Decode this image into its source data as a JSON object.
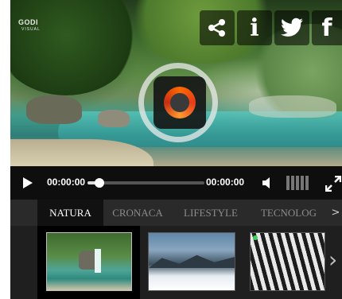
{
  "logo": {
    "text": "GODI",
    "sub": "VISUAL"
  },
  "share": {
    "buttons": [
      {
        "name": "share",
        "icon": "share-icon"
      },
      {
        "name": "info",
        "icon": "info-icon",
        "glyph": "i"
      },
      {
        "name": "twitter",
        "icon": "twitter-icon"
      },
      {
        "name": "facebook",
        "icon": "facebook-icon",
        "glyph": "f"
      }
    ]
  },
  "loader": {
    "icon": "loading-spinner-icon",
    "accent": "#ff6a00"
  },
  "controls": {
    "play_icon": "play-icon",
    "current_time": "00:00:00",
    "total_time": "00:00:00",
    "progress_fraction": 0.1,
    "volume_icon": "speaker-icon",
    "volume_bars_total": 5,
    "volume_bars_on": 0,
    "fullscreen_icon": "fullscreen-icon"
  },
  "tabs": {
    "items": [
      {
        "label": "NATURA",
        "active": true
      },
      {
        "label": "CRONACA",
        "active": false
      },
      {
        "label": "LIFESTYLE",
        "active": false
      },
      {
        "label": "TECNOLOG",
        "active": false
      }
    ],
    "next_glyph": ">"
  },
  "thumbnails": {
    "items": [
      {
        "subject": "waterfall",
        "active": true
      },
      {
        "subject": "snowy-landscape",
        "active": false
      },
      {
        "subject": "zebra",
        "active": false
      }
    ],
    "next_glyph": "›"
  },
  "colors": {
    "bar_bg": "#0e0e0e",
    "tabs_bg": "#2a2a2a",
    "active_tab_bg": "#111111",
    "accent": "#ff6a00"
  }
}
